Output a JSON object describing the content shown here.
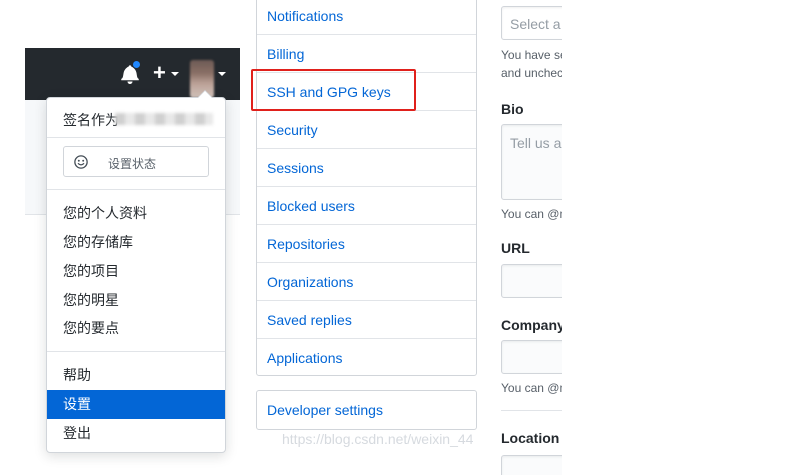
{
  "header": {
    "notification_color": "#2188ff",
    "plus_symbol": "+"
  },
  "dropdown": {
    "signed_in_prefix": "签名作为",
    "status_label": "设置状态",
    "items": [
      {
        "label": "您的个人资料"
      },
      {
        "label": "您的存储库"
      },
      {
        "label": "您的项目"
      },
      {
        "label": "您的明星"
      },
      {
        "label": "您的要点"
      }
    ],
    "help_label": "帮助",
    "settings_label": "设置",
    "signout_label": "登出"
  },
  "settings_menu": {
    "items": [
      {
        "label": "Notifications"
      },
      {
        "label": "Billing"
      },
      {
        "label": "SSH and GPG keys"
      },
      {
        "label": "Security"
      },
      {
        "label": "Sessions"
      },
      {
        "label": "Blocked users"
      },
      {
        "label": "Repositories"
      },
      {
        "label": "Organizations"
      },
      {
        "label": "Saved replies"
      },
      {
        "label": "Applications"
      }
    ],
    "developer_settings_label": "Developer settings",
    "highlight_color": "#e0201b"
  },
  "profile_form": {
    "select_placeholder": "Select a v",
    "select_note_line1": "You have se",
    "select_note_line2": "and unchec",
    "bio_label": "Bio",
    "bio_placeholder": "Tell us a",
    "bio_note": "You can @m",
    "url_label": "URL",
    "company_label": "Company",
    "company_note": "You can @m",
    "location_label": "Location"
  },
  "watermark": "https://blog.csdn.net/weixin_44"
}
